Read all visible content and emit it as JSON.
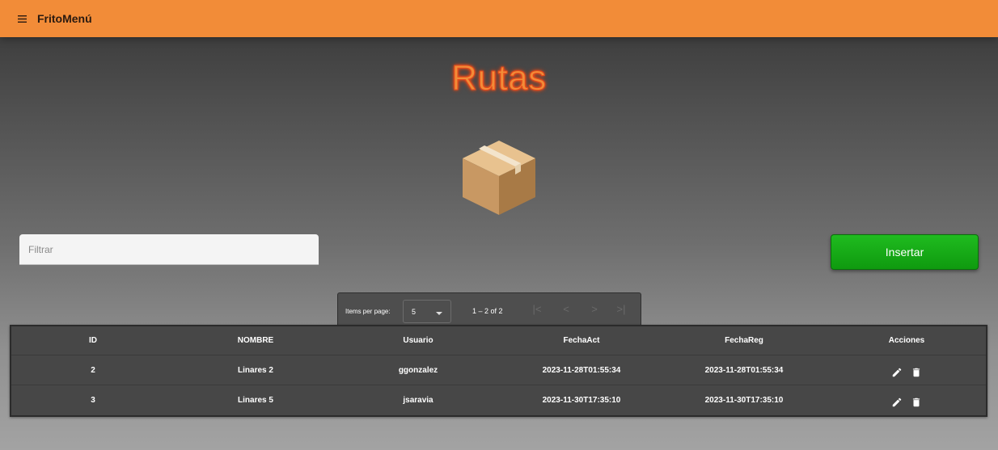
{
  "app": {
    "brand": "FritoMenú"
  },
  "page": {
    "title": "Rutas"
  },
  "filter": {
    "placeholder": "Filtrar",
    "value": ""
  },
  "insert_button": {
    "label": "Insertar"
  },
  "paginator": {
    "items_per_page_label": "Items per page:",
    "page_size": "5",
    "range_label": "1 – 2 of 2"
  },
  "table": {
    "columns": [
      "ID",
      "NOMBRE",
      "Usuario",
      "FechaAct",
      "FechaReg",
      "Acciones"
    ],
    "rows": [
      {
        "id": "2",
        "nombre": "Linares 2",
        "usuario": "ggonzalez",
        "fecha_act": "2023-11-28T01:55:34",
        "fecha_reg": "2023-11-28T01:55:34"
      },
      {
        "id": "3",
        "nombre": "Linares 5",
        "usuario": "jsaravia",
        "fecha_act": "2023-11-30T17:35:10",
        "fecha_reg": "2023-11-30T17:35:10"
      }
    ]
  },
  "icons": {
    "menu": "menu-icon",
    "box": "package-box-icon",
    "edit": "pencil-icon",
    "delete": "trash-icon",
    "first_page": "first-page-icon",
    "prev_page": "chevron-left-icon",
    "next_page": "chevron-right-icon",
    "last_page": "last-page-icon"
  },
  "colors": {
    "toolbar": "#f28c38",
    "title": "#f28c38",
    "insert": "#13a613"
  }
}
